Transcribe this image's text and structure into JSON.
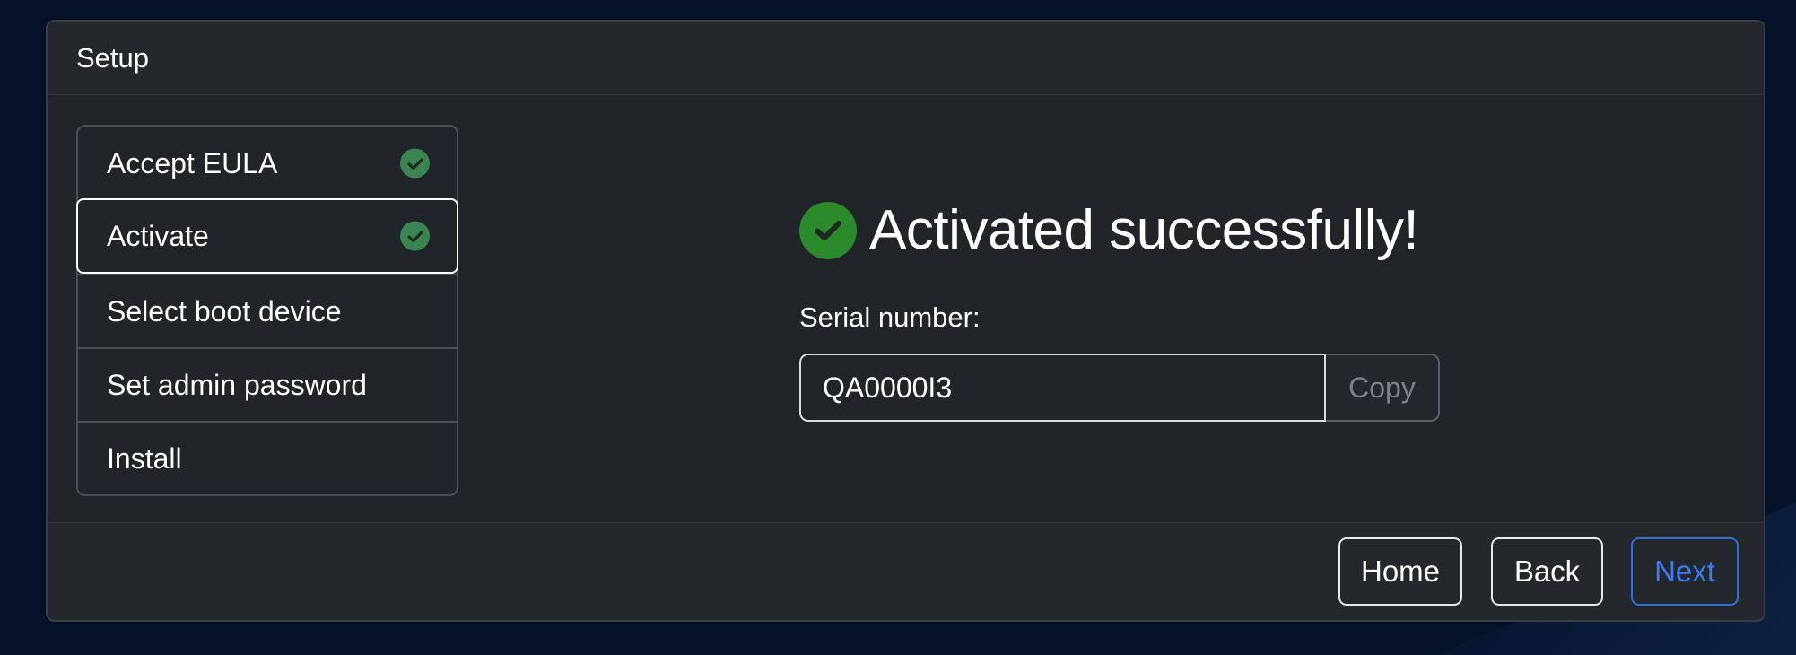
{
  "header": {
    "title": "Setup"
  },
  "steps": [
    {
      "label": "Accept EULA",
      "completed": true,
      "active": false
    },
    {
      "label": "Activate",
      "completed": true,
      "active": true
    },
    {
      "label": "Select boot device",
      "completed": false,
      "active": false
    },
    {
      "label": "Set admin password",
      "completed": false,
      "active": false
    },
    {
      "label": "Install",
      "completed": false,
      "active": false
    }
  ],
  "main": {
    "success_message": "Activated successfully!",
    "serial_label": "Serial number:",
    "serial_value": "QA0000I3",
    "copy_label": "Copy"
  },
  "footer": {
    "home_label": "Home",
    "back_label": "Back",
    "next_label": "Next"
  },
  "icons": {
    "step_check": "check-circle-icon",
    "success": "check-circle-icon"
  },
  "colors": {
    "background": "#06112a",
    "card": "#212529",
    "check_green": "#3b8553",
    "success_green": "#2b8a2b",
    "primary_blue": "#2e6ee0"
  }
}
